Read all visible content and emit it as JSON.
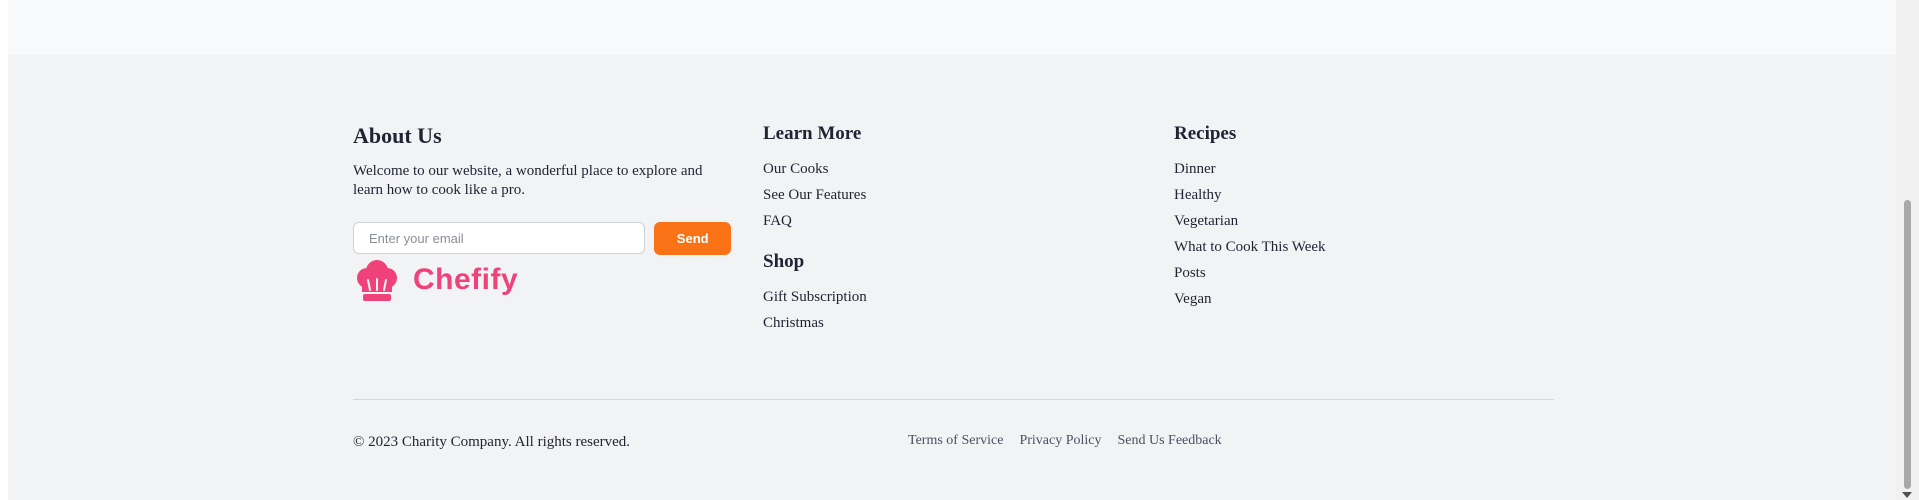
{
  "about": {
    "heading": "About Us",
    "description": "Welcome to our website, a wonderful place to explore and learn how to cook like a pro.",
    "email_placeholder": "Enter your email",
    "send_label": "Send",
    "brand_name": "Chefify",
    "brand_color": "#f0427a",
    "accent_color": "#f97316"
  },
  "learn_more": {
    "heading": "Learn More",
    "items": [
      "Our Cooks",
      "See Our Features",
      "FAQ"
    ]
  },
  "shop": {
    "heading": "Shop",
    "items": [
      "Gift Subscription",
      "Christmas"
    ]
  },
  "recipes": {
    "heading": "Recipes",
    "items": [
      "Dinner",
      "Healthy",
      "Vegetarian",
      "What to Cook This Week",
      "Posts",
      "Vegan"
    ]
  },
  "bottom": {
    "copyright": "© 2023 Charity Company. All rights reserved.",
    "links": [
      "Terms of Service",
      "Privacy Policy",
      "Send Us Feedback"
    ]
  }
}
